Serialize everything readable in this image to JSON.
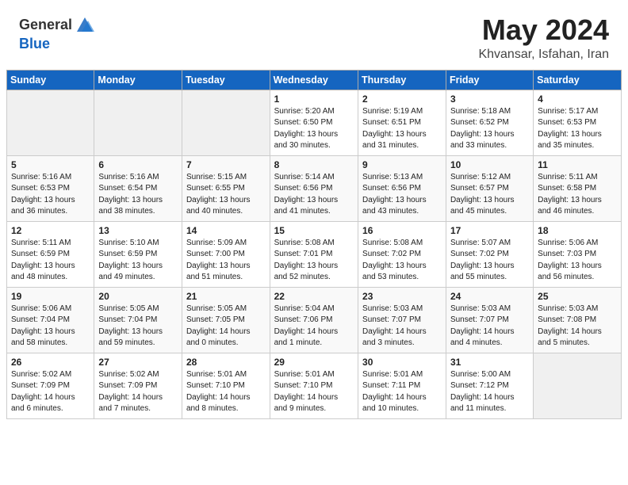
{
  "header": {
    "logo_general": "General",
    "logo_blue": "Blue",
    "title": "May 2024",
    "subtitle": "Khvansar, Isfahan, Iran"
  },
  "days_of_week": [
    "Sunday",
    "Monday",
    "Tuesday",
    "Wednesday",
    "Thursday",
    "Friday",
    "Saturday"
  ],
  "weeks": [
    [
      {
        "day": "",
        "info": ""
      },
      {
        "day": "",
        "info": ""
      },
      {
        "day": "",
        "info": ""
      },
      {
        "day": "1",
        "info": "Sunrise: 5:20 AM\nSunset: 6:50 PM\nDaylight: 13 hours\nand 30 minutes."
      },
      {
        "day": "2",
        "info": "Sunrise: 5:19 AM\nSunset: 6:51 PM\nDaylight: 13 hours\nand 31 minutes."
      },
      {
        "day": "3",
        "info": "Sunrise: 5:18 AM\nSunset: 6:52 PM\nDaylight: 13 hours\nand 33 minutes."
      },
      {
        "day": "4",
        "info": "Sunrise: 5:17 AM\nSunset: 6:53 PM\nDaylight: 13 hours\nand 35 minutes."
      }
    ],
    [
      {
        "day": "5",
        "info": "Sunrise: 5:16 AM\nSunset: 6:53 PM\nDaylight: 13 hours\nand 36 minutes."
      },
      {
        "day": "6",
        "info": "Sunrise: 5:16 AM\nSunset: 6:54 PM\nDaylight: 13 hours\nand 38 minutes."
      },
      {
        "day": "7",
        "info": "Sunrise: 5:15 AM\nSunset: 6:55 PM\nDaylight: 13 hours\nand 40 minutes."
      },
      {
        "day": "8",
        "info": "Sunrise: 5:14 AM\nSunset: 6:56 PM\nDaylight: 13 hours\nand 41 minutes."
      },
      {
        "day": "9",
        "info": "Sunrise: 5:13 AM\nSunset: 6:56 PM\nDaylight: 13 hours\nand 43 minutes."
      },
      {
        "day": "10",
        "info": "Sunrise: 5:12 AM\nSunset: 6:57 PM\nDaylight: 13 hours\nand 45 minutes."
      },
      {
        "day": "11",
        "info": "Sunrise: 5:11 AM\nSunset: 6:58 PM\nDaylight: 13 hours\nand 46 minutes."
      }
    ],
    [
      {
        "day": "12",
        "info": "Sunrise: 5:11 AM\nSunset: 6:59 PM\nDaylight: 13 hours\nand 48 minutes."
      },
      {
        "day": "13",
        "info": "Sunrise: 5:10 AM\nSunset: 6:59 PM\nDaylight: 13 hours\nand 49 minutes."
      },
      {
        "day": "14",
        "info": "Sunrise: 5:09 AM\nSunset: 7:00 PM\nDaylight: 13 hours\nand 51 minutes."
      },
      {
        "day": "15",
        "info": "Sunrise: 5:08 AM\nSunset: 7:01 PM\nDaylight: 13 hours\nand 52 minutes."
      },
      {
        "day": "16",
        "info": "Sunrise: 5:08 AM\nSunset: 7:02 PM\nDaylight: 13 hours\nand 53 minutes."
      },
      {
        "day": "17",
        "info": "Sunrise: 5:07 AM\nSunset: 7:02 PM\nDaylight: 13 hours\nand 55 minutes."
      },
      {
        "day": "18",
        "info": "Sunrise: 5:06 AM\nSunset: 7:03 PM\nDaylight: 13 hours\nand 56 minutes."
      }
    ],
    [
      {
        "day": "19",
        "info": "Sunrise: 5:06 AM\nSunset: 7:04 PM\nDaylight: 13 hours\nand 58 minutes."
      },
      {
        "day": "20",
        "info": "Sunrise: 5:05 AM\nSunset: 7:04 PM\nDaylight: 13 hours\nand 59 minutes."
      },
      {
        "day": "21",
        "info": "Sunrise: 5:05 AM\nSunset: 7:05 PM\nDaylight: 14 hours\nand 0 minutes."
      },
      {
        "day": "22",
        "info": "Sunrise: 5:04 AM\nSunset: 7:06 PM\nDaylight: 14 hours\nand 1 minute."
      },
      {
        "day": "23",
        "info": "Sunrise: 5:03 AM\nSunset: 7:07 PM\nDaylight: 14 hours\nand 3 minutes."
      },
      {
        "day": "24",
        "info": "Sunrise: 5:03 AM\nSunset: 7:07 PM\nDaylight: 14 hours\nand 4 minutes."
      },
      {
        "day": "25",
        "info": "Sunrise: 5:03 AM\nSunset: 7:08 PM\nDaylight: 14 hours\nand 5 minutes."
      }
    ],
    [
      {
        "day": "26",
        "info": "Sunrise: 5:02 AM\nSunset: 7:09 PM\nDaylight: 14 hours\nand 6 minutes."
      },
      {
        "day": "27",
        "info": "Sunrise: 5:02 AM\nSunset: 7:09 PM\nDaylight: 14 hours\nand 7 minutes."
      },
      {
        "day": "28",
        "info": "Sunrise: 5:01 AM\nSunset: 7:10 PM\nDaylight: 14 hours\nand 8 minutes."
      },
      {
        "day": "29",
        "info": "Sunrise: 5:01 AM\nSunset: 7:10 PM\nDaylight: 14 hours\nand 9 minutes."
      },
      {
        "day": "30",
        "info": "Sunrise: 5:01 AM\nSunset: 7:11 PM\nDaylight: 14 hours\nand 10 minutes."
      },
      {
        "day": "31",
        "info": "Sunrise: 5:00 AM\nSunset: 7:12 PM\nDaylight: 14 hours\nand 11 minutes."
      },
      {
        "day": "",
        "info": ""
      }
    ]
  ]
}
